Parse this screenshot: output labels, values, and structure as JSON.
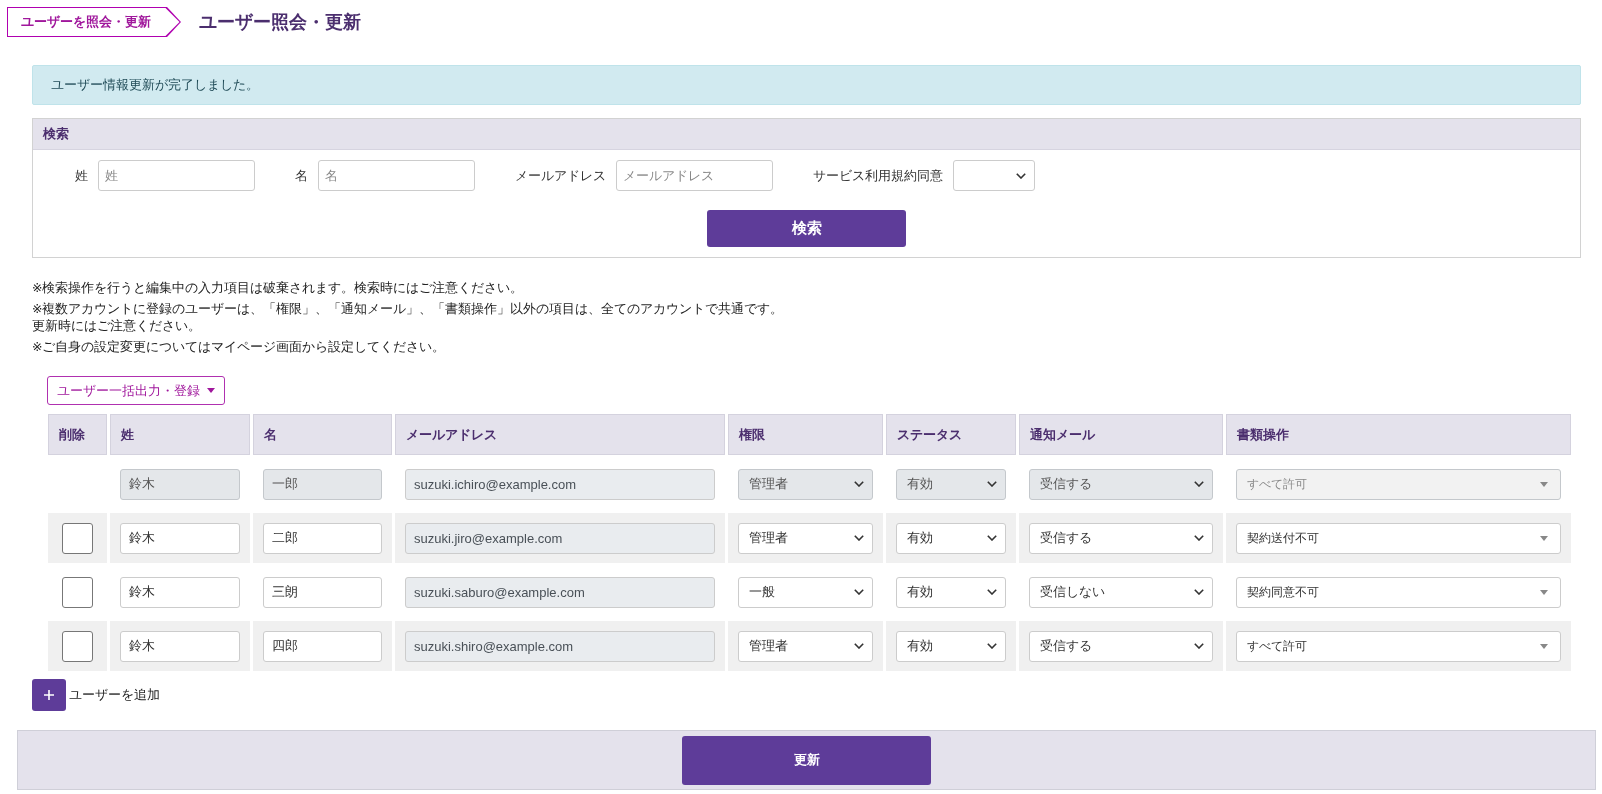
{
  "breadcrumb": {
    "label": "ユーザーを照会・更新"
  },
  "page_title": "ユーザー照会・更新",
  "alert": {
    "message": "ユーザー情報更新が完了しました。"
  },
  "search": {
    "title": "検索",
    "fields": [
      {
        "kind": "text",
        "label": "姓",
        "placeholder": "姓"
      },
      {
        "kind": "text",
        "label": "名",
        "placeholder": "名"
      },
      {
        "kind": "text",
        "label": "メールアドレス",
        "placeholder": "メールアドレス"
      },
      {
        "kind": "select",
        "label": "サービス利用規約同意"
      }
    ],
    "button": "検索"
  },
  "notes": [
    {
      "lines": [
        "※検索操作を行うと編集中の入力項目は破棄されます。検索時にはご注意ください。"
      ]
    },
    {
      "lines": [
        "※複数アカウントに登録のユーザーは、「権限」、「通知メール」、「書類操作」以外の項目は、全てのアカウントで共通です。",
        "更新時にはご注意ください。"
      ]
    },
    {
      "lines": [
        "※ご自身の設定変更についてはマイページ画面から設定してください。"
      ]
    }
  ],
  "bulk_menu": {
    "label": "ユーザー一括出力・登録"
  },
  "table": {
    "columns": [
      "削除",
      "姓",
      "名",
      "メールアドレス",
      "権限",
      "ステータス",
      "通知メール",
      "書類操作"
    ],
    "rows": [
      {
        "disabled": true,
        "last_name": "鈴木",
        "first_name": "一郎",
        "email": "suzuki.ichiro@example.com",
        "role": "管理者",
        "status": "有効",
        "notification": "受信する",
        "document_permission": "すべて許可"
      },
      {
        "delete": {
          "checked": false
        },
        "disabled": false,
        "last_name": "鈴木",
        "first_name": "二郎",
        "email": "suzuki.jiro@example.com",
        "role": "管理者",
        "status": "有効",
        "notification": "受信する",
        "document_permission": "契約送付不可"
      },
      {
        "delete": {
          "checked": false
        },
        "disabled": false,
        "last_name": "鈴木",
        "first_name": "三朗",
        "email": "suzuki.saburo@example.com",
        "role": "一般",
        "status": "有効",
        "notification": "受信しない",
        "document_permission": "契約同意不可"
      },
      {
        "delete": {
          "checked": false
        },
        "disabled": false,
        "last_name": "鈴木",
        "first_name": "四郎",
        "email": "suzuki.shiro@example.com",
        "role": "管理者",
        "status": "有効",
        "notification": "受信する",
        "document_permission": "すべて許可"
      }
    ]
  },
  "add_user": {
    "label": "ユーザーを追加"
  },
  "footer": {
    "button": "更新"
  }
}
